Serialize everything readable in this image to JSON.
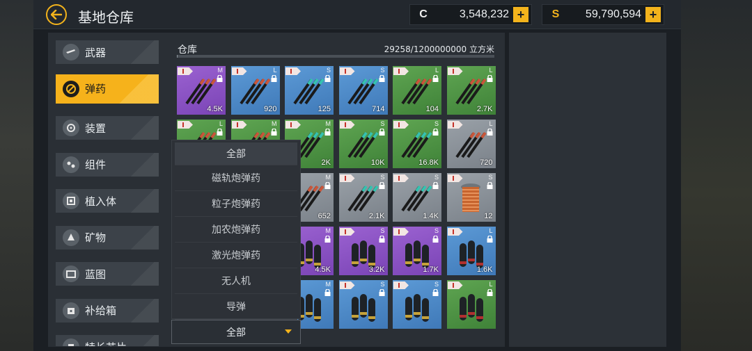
{
  "header": {
    "title": "基地仓库",
    "currencies": [
      {
        "icon": "C",
        "icon_name": "credits-icon",
        "value": "3,548,232"
      },
      {
        "icon": "S",
        "icon_name": "gold-coin-icon",
        "value": "59,790,594"
      }
    ]
  },
  "sidebar": {
    "items": [
      {
        "label": "武器",
        "icon": "weapon-icon",
        "active": false
      },
      {
        "label": "弹药",
        "icon": "ammo-icon",
        "active": true
      },
      {
        "label": "装置",
        "icon": "device-icon",
        "active": false
      },
      {
        "label": "组件",
        "icon": "component-icon",
        "active": false
      },
      {
        "label": "植入体",
        "icon": "implant-icon",
        "active": false
      },
      {
        "label": "矿物",
        "icon": "mineral-icon",
        "active": false
      },
      {
        "label": "蓝图",
        "icon": "blueprint-icon",
        "active": false
      },
      {
        "label": "补给箱",
        "icon": "supply-box-icon",
        "active": false
      },
      {
        "label": "特长芯片",
        "icon": "chip-icon",
        "active": false
      }
    ]
  },
  "warehouse": {
    "title": "仓库",
    "capacity": "29258/1200000000 立方米",
    "usage_fraction": 2.44e-05
  },
  "items": [
    {
      "color": "purple",
      "size": "M",
      "qty": "4.5K",
      "art": "railgun-ammo",
      "row": 0,
      "col": 0
    },
    {
      "color": "blue",
      "size": "L",
      "qty": "920",
      "art": "railgun-ammo",
      "row": 0,
      "col": 1
    },
    {
      "color": "blue",
      "size": "S",
      "qty": "125",
      "art": "particle-ammo",
      "row": 0,
      "col": 2
    },
    {
      "color": "blue",
      "size": "S",
      "qty": "714",
      "art": "particle-ammo",
      "row": 0,
      "col": 3
    },
    {
      "color": "green",
      "size": "L",
      "qty": "104",
      "art": "railgun-ammo",
      "row": 0,
      "col": 4
    },
    {
      "color": "green",
      "size": "L",
      "qty": "2.7K",
      "art": "railgun-ammo",
      "row": 0,
      "col": 5
    },
    {
      "color": "green",
      "size": "L",
      "qty": "",
      "art": "railgun-ammo",
      "row": 1,
      "col": 0
    },
    {
      "color": "green",
      "size": "M",
      "qty": "",
      "art": "railgun-ammo",
      "row": 1,
      "col": 1
    },
    {
      "color": "green",
      "size": "M",
      "qty": "2K",
      "art": "particle-ammo",
      "row": 1,
      "col": 2
    },
    {
      "color": "green",
      "size": "S",
      "qty": "10K",
      "art": "particle-ammo",
      "row": 1,
      "col": 3
    },
    {
      "color": "green",
      "size": "S",
      "qty": "16.8K",
      "art": "particle-ammo",
      "row": 1,
      "col": 4
    },
    {
      "color": "gray",
      "size": "L",
      "qty": "720",
      "art": "railgun-ammo",
      "row": 1,
      "col": 5
    },
    {
      "color": "gray",
      "size": "M",
      "qty": "652",
      "art": "railgun-ammo",
      "row": 2,
      "col": 2
    },
    {
      "color": "gray",
      "size": "S",
      "qty": "2.1K",
      "art": "particle-ammo",
      "row": 2,
      "col": 3
    },
    {
      "color": "gray",
      "size": "S",
      "qty": "1.4K",
      "art": "particle-ammo",
      "row": 2,
      "col": 4
    },
    {
      "color": "gray",
      "size": "S",
      "qty": "12",
      "art": "coil-ammo",
      "row": 2,
      "col": 5
    },
    {
      "color": "purple",
      "size": "M",
      "qty": "4.5K",
      "art": "cannon-shells",
      "row": 3,
      "col": 2
    },
    {
      "color": "purple",
      "size": "S",
      "qty": "3.2K",
      "art": "cannon-shells",
      "row": 3,
      "col": 3
    },
    {
      "color": "purple",
      "size": "S",
      "qty": "1.7K",
      "art": "cannon-shells",
      "row": 3,
      "col": 4
    },
    {
      "color": "blue",
      "size": "L",
      "qty": "1.6K",
      "art": "heavy-shells",
      "row": 3,
      "col": 5
    },
    {
      "color": "blue",
      "size": "M",
      "qty": "",
      "art": "cannon-shells",
      "row": 4,
      "col": 2
    },
    {
      "color": "blue",
      "size": "S",
      "qty": "",
      "art": "cannon-shells",
      "row": 4,
      "col": 3
    },
    {
      "color": "blue",
      "size": "S",
      "qty": "",
      "art": "cannon-shells",
      "row": 4,
      "col": 4
    },
    {
      "color": "green",
      "size": "L",
      "qty": "",
      "art": "heavy-shells",
      "row": 4,
      "col": 5
    }
  ],
  "filter": {
    "selected": "全部",
    "options": [
      "全部",
      "磁轨炮弹药",
      "粒子炮弹药",
      "加农炮弹药",
      "激光炮弹药",
      "无人机",
      "导弹"
    ]
  }
}
